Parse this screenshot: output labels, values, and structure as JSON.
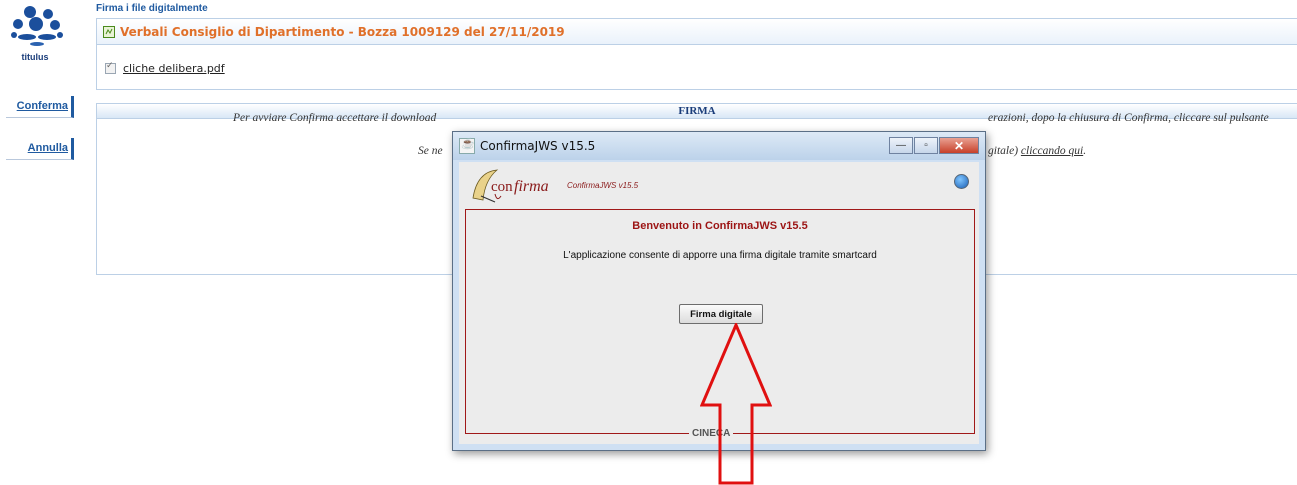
{
  "logo": {
    "caption": "titulus"
  },
  "nav": {
    "confirm_label": "Conferma",
    "cancel_label": "Annulla"
  },
  "main": {
    "section_title": "Firma i file digitalmente",
    "document_title": "Verbali Consiglio di Dipartimento - Bozza 1009129 del 27/11/2019",
    "file": {
      "name": "cliche delibera.pdf",
      "checked": true
    }
  },
  "firma": {
    "header": "FIRMA",
    "instruction_line1_left": "Per avviare Confirma accettare il download",
    "instruction_line1_right": "erazioni, dopo la chiusura di Confirma, cliccare sul pulsante",
    "instruction_line2_left": "Se ne",
    "instruction_line2_right": "gitale)",
    "instruction_link": "cliccando qui",
    "instruction_line2_end": "."
  },
  "dialog": {
    "title": "ConfirmaJWS v15.5",
    "logo_version": "ConfirmaJWS v15.5",
    "welcome": "Benvenuto in ConfirmaJWS v15.5",
    "description": "L'applicazione consente di apporre una firma digitale tramite smartcard",
    "sign_button": "Firma digitale",
    "footer": "CINECA",
    "window_buttons": {
      "minimize": "—",
      "maximize": "▫",
      "close": "✕"
    }
  },
  "colors": {
    "accent_blue": "#1f5aa0",
    "doc_title_orange": "#e0702a",
    "dialog_red": "#9c1414",
    "arrow_red": "#e01010"
  }
}
